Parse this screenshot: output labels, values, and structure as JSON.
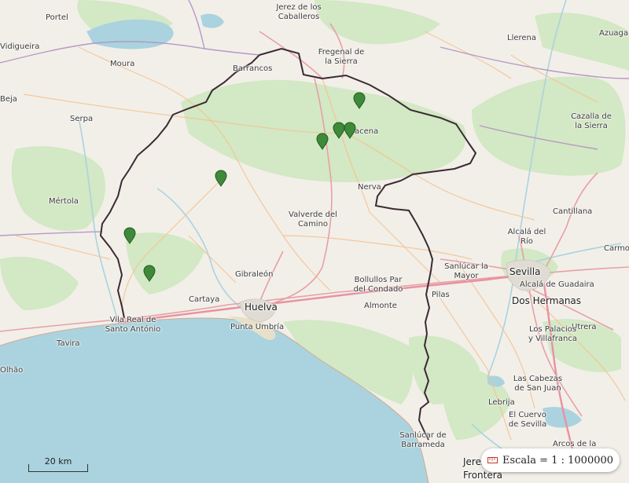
{
  "map": {
    "places": [
      {
        "id": "portel",
        "label": "Portel"
      },
      {
        "id": "vidigueira",
        "label": "Vidigueira"
      },
      {
        "id": "moura",
        "label": "Moura"
      },
      {
        "id": "beja",
        "label": "Beja"
      },
      {
        "id": "serpa",
        "label": "Serpa"
      },
      {
        "id": "mertola",
        "label": "Mértola"
      },
      {
        "id": "jerez",
        "label": "Jerez de los\nCaballeros"
      },
      {
        "id": "fregenal",
        "label": "Fregenal de\nla Sierra"
      },
      {
        "id": "barrancos",
        "label": "Barrancos"
      },
      {
        "id": "llerena",
        "label": "Llerena"
      },
      {
        "id": "azuaga",
        "label": "Azuaga"
      },
      {
        "id": "cazalla",
        "label": "Cazalla de\nla Sierra"
      },
      {
        "id": "aracena",
        "label": "Aracena"
      },
      {
        "id": "nerva",
        "label": "Nerva"
      },
      {
        "id": "valverde",
        "label": "Valverde del\nCamino"
      },
      {
        "id": "cantillana",
        "label": "Cantillana"
      },
      {
        "id": "alcala_rio",
        "label": "Alcalá del\nRío"
      },
      {
        "id": "carmona",
        "label": "Carmo"
      },
      {
        "id": "sanlucar_mayor",
        "label": "Sanlúcar la\nMayor"
      },
      {
        "id": "sevilla",
        "label": "Sevilla"
      },
      {
        "id": "alcala_guadaira",
        "label": "Alcalá de Guadaira"
      },
      {
        "id": "dos_hermanas",
        "label": "Dos Hermanas"
      },
      {
        "id": "gibraleon",
        "label": "Gibraleón"
      },
      {
        "id": "bollullos",
        "label": "Bollullos Par\ndel Condado"
      },
      {
        "id": "pilas",
        "label": "Pilas"
      },
      {
        "id": "cartaya",
        "label": "Cartaya"
      },
      {
        "id": "huelva",
        "label": "Huelva"
      },
      {
        "id": "almonte",
        "label": "Almonte"
      },
      {
        "id": "utrera",
        "label": "Utrera"
      },
      {
        "id": "vila_real",
        "label": "Vila Real de\nSanto António"
      },
      {
        "id": "punta_umbria",
        "label": "Punta Umbría"
      },
      {
        "id": "tavira",
        "label": "Tavira"
      },
      {
        "id": "olhao",
        "label": "Olhão"
      },
      {
        "id": "los_palacios",
        "label": "Los Palacios\ny Villafranca"
      },
      {
        "id": "las_cabezas",
        "label": "Las Cabezas\nde San Juan"
      },
      {
        "id": "lebrija",
        "label": "Lebrija"
      },
      {
        "id": "el_cuervo",
        "label": "El Cuervo\nde Sevilla"
      },
      {
        "id": "arcos",
        "label": "Arcos de la"
      },
      {
        "id": "sanlucar_barrameda",
        "label": "Sanlúcar de\nBarrameda"
      },
      {
        "id": "jerez_frontera",
        "label": "Jerez\nFrontera"
      }
    ],
    "markers": [
      {
        "id": "marker-1",
        "color": "#3f8a3a"
      },
      {
        "id": "marker-2",
        "color": "#3f8a3a"
      },
      {
        "id": "marker-3",
        "color": "#3f8a3a"
      },
      {
        "id": "marker-4",
        "color": "#3f8a3a"
      },
      {
        "id": "marker-5",
        "color": "#3f8a3a"
      },
      {
        "id": "marker-6",
        "color": "#3f8a3a"
      },
      {
        "id": "marker-7",
        "color": "#3f8a3a"
      }
    ],
    "colors": {
      "land": "#f2efe9",
      "forest": "#cfe5bf",
      "sea": "#aad3df",
      "boundary": "#3b2a33",
      "road": "#e8a0a4",
      "motorway": "#e892a2"
    }
  },
  "scalebar": {
    "label": "20 km"
  },
  "scale_control": {
    "label": "Escala = 1 : 1000000",
    "icon": "ruler-icon"
  }
}
